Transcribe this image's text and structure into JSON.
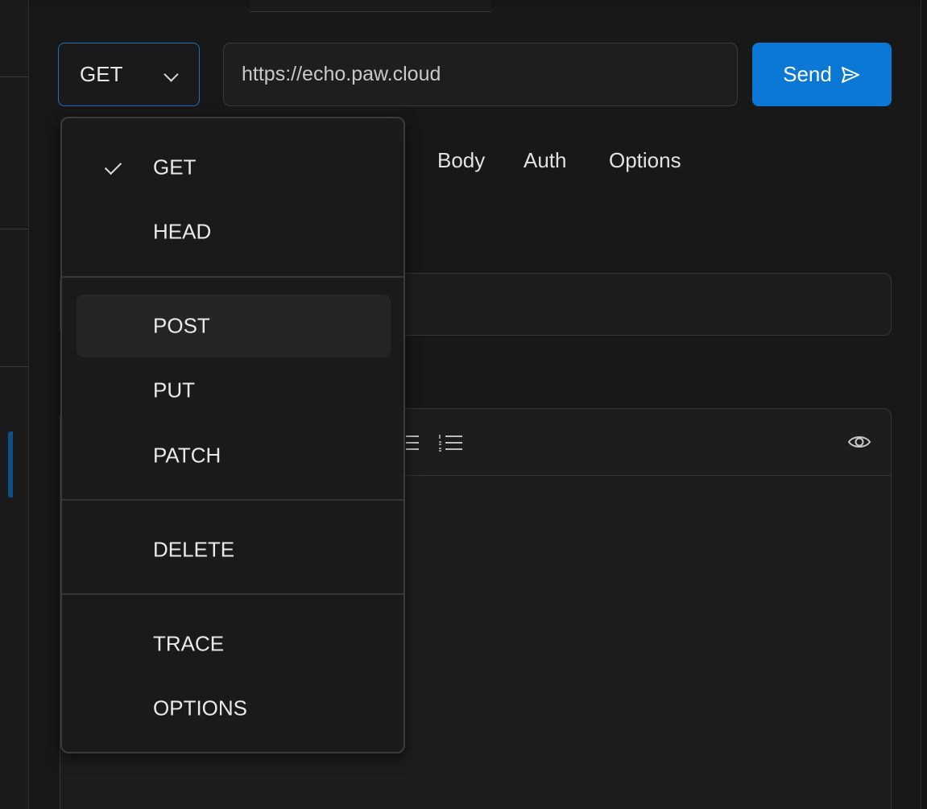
{
  "request": {
    "method": "GET",
    "url": "https://echo.paw.cloud",
    "send_label": "Send"
  },
  "tabs": [
    {
      "label": "Body"
    },
    {
      "label": "Auth"
    },
    {
      "label": "Options"
    }
  ],
  "method_menu": {
    "selected": "GET",
    "hovered": "POST",
    "items": [
      {
        "label": "GET"
      },
      {
        "label": "HEAD"
      },
      {
        "label": "POST"
      },
      {
        "label": "PUT"
      },
      {
        "label": "PATCH"
      },
      {
        "label": "DELETE"
      },
      {
        "label": "TRACE"
      },
      {
        "label": "OPTIONS"
      }
    ]
  },
  "icons": {
    "send": "send-arrow-icon",
    "method_dropdown": "chevron-down-icon",
    "checked": "check-icon",
    "bulleted_list": "bulleted-list-icon",
    "numbered_list": "numbered-list-icon",
    "preview": "eye-icon"
  },
  "colors": {
    "accent": "#0a78d4",
    "background": "#161616",
    "panel": "#1d1d1d",
    "menu": "#1a1a1a"
  }
}
